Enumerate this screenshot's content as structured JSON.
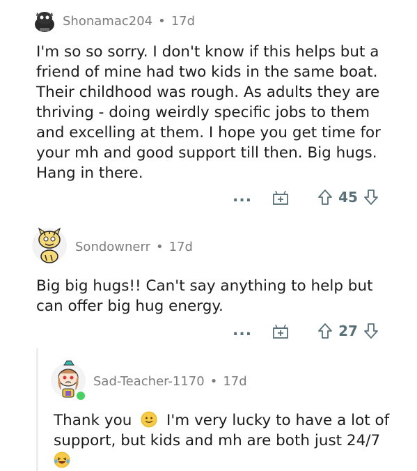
{
  "comments": [
    {
      "username": "Shonamac204",
      "separator": "•",
      "time": "17d",
      "lines": [
        "I'm so so sorry.  I don't know if this helps but a",
        "friend of mine had two kids in the same boat.",
        "Their childhood was rough.  As adults they are",
        "thriving - doing weirdly specific jobs to them",
        "and excelling at them.  I hope you get time for",
        "your mh and good support till then.  Big hugs.",
        "Hang in there."
      ],
      "more": "...",
      "votes": "45"
    },
    {
      "username": "Sondownerr",
      "separator": "•",
      "time": "17d",
      "lines": [
        "Big big hugs!! Can't say anything to help but",
        "can offer big hug energy."
      ],
      "more": "...",
      "votes": "27"
    },
    {
      "username": "Sad-Teacher-1170",
      "separator": "•",
      "time": "17d",
      "line1_a": "Thank you",
      "line1_b": "I'm very lucky to have a lot of",
      "line2": "support, but kids and mh are both just 24/7"
    }
  ],
  "colors": {
    "meta": "#7c7c7c",
    "icon": "#576f76",
    "text": "#1c1c1c",
    "online": "#46d160"
  }
}
